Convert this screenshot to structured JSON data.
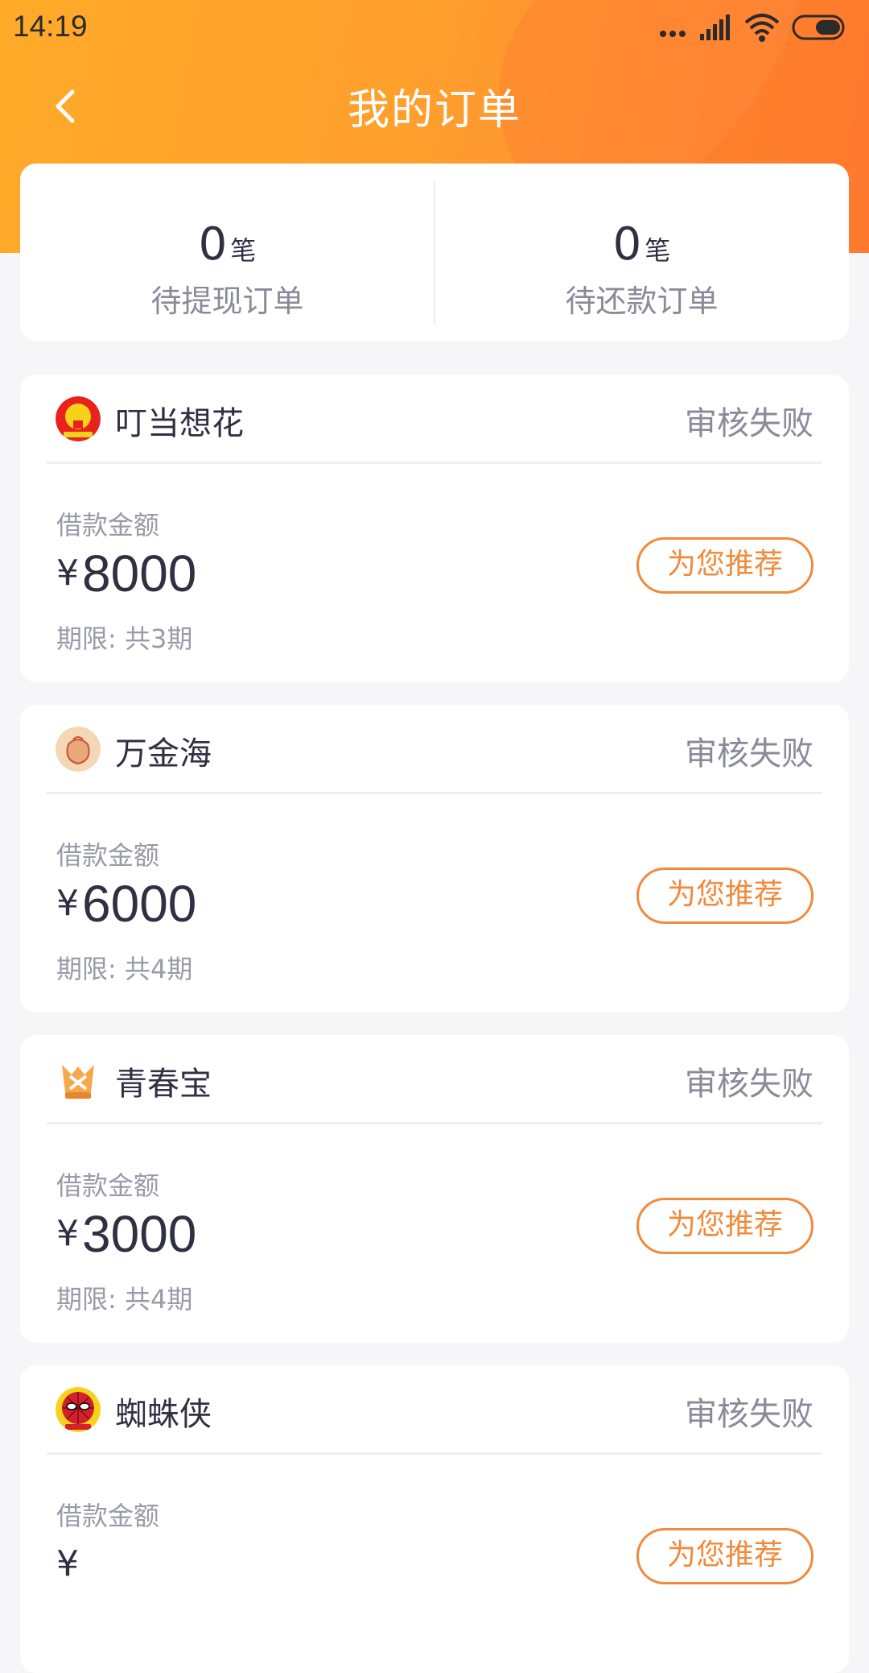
{
  "status_bar": {
    "time": "14:19"
  },
  "nav": {
    "title": "我的订单"
  },
  "summary": {
    "pending_withdraw": {
      "count": "0",
      "unit": "笔",
      "label": "待提现订单"
    },
    "pending_repay": {
      "count": "0",
      "unit": "笔",
      "label": "待还款订单"
    }
  },
  "orders": [
    {
      "lender": "叮当想花",
      "status": "审核失败",
      "amount_label": "借款金额",
      "currency": "¥",
      "amount": "8000",
      "term": "期限: 共3期",
      "button": "为您推荐"
    },
    {
      "lender": "万金海",
      "status": "审核失败",
      "amount_label": "借款金额",
      "currency": "¥",
      "amount": "6000",
      "term": "期限: 共4期",
      "button": "为您推荐"
    },
    {
      "lender": "青春宝",
      "status": "审核失败",
      "amount_label": "借款金额",
      "currency": "¥",
      "amount": "3000",
      "term": "期限: 共4期",
      "button": "为您推荐"
    },
    {
      "lender": "蜘蛛侠",
      "status": "审核失败",
      "amount_label": "借款金额",
      "currency": "¥",
      "amount": "",
      "term": "",
      "button": "为您推荐"
    }
  ],
  "colors": {
    "accent": "#f28a3a",
    "header_start": "#ffa51c",
    "header_end": "#ff7a2e"
  }
}
